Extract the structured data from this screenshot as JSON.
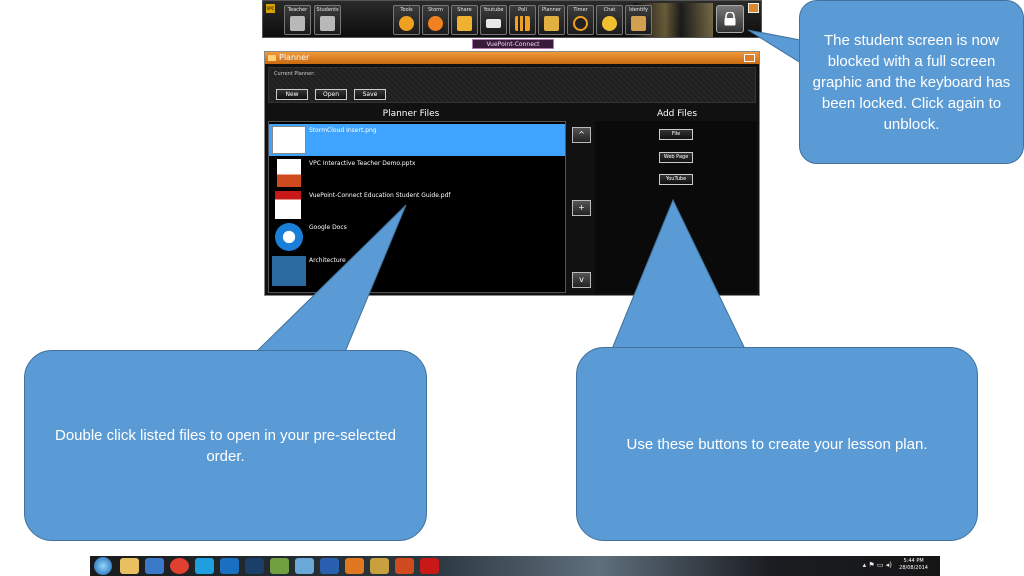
{
  "toolbar": {
    "logo_text": "VPC",
    "buttons": [
      {
        "id": "teacher",
        "label": "Teacher",
        "icon": "teacher-desk-icon",
        "color": "#b8b8b8"
      },
      {
        "id": "students",
        "label": "Students",
        "icon": "students-desk-icon",
        "color": "#b8b8b8"
      },
      {
        "id": "tools",
        "label": "Tools",
        "icon": "gear-tools-icon",
        "color": "#f0a020"
      },
      {
        "id": "storm",
        "label": "Storm",
        "icon": "storm-cloud-icon",
        "color": "#f08020"
      },
      {
        "id": "share",
        "label": "Share",
        "icon": "share-document-icon",
        "color": "#f0b030"
      },
      {
        "id": "youtube",
        "label": "Youtube",
        "icon": "youtube-icon",
        "color": "#e8e8e8"
      },
      {
        "id": "poll",
        "label": "Poll",
        "icon": "poll-chart-icon",
        "color": "#f0a020"
      },
      {
        "id": "planner",
        "label": "Planner",
        "icon": "planner-calendar-icon",
        "color": "#e0b040"
      },
      {
        "id": "timer",
        "label": "Timer",
        "icon": "timer-clock-icon",
        "color": "#f0a020"
      },
      {
        "id": "chat",
        "label": "Chat",
        "icon": "chat-bubble-icon",
        "color": "#f0c030"
      },
      {
        "id": "identify",
        "label": "Identify",
        "icon": "identify-desk-icon",
        "color": "#d0a050"
      }
    ],
    "lock_icon": "lock-icon",
    "brand": "VuePoint-Connect"
  },
  "planner": {
    "title": "Planner",
    "current_label": "Current Planner:",
    "buttons": {
      "new": "New",
      "open": "Open",
      "save": "Save"
    },
    "files_header": "Planner Files",
    "add_header": "Add Files",
    "files": [
      {
        "name": "StormCloud Insert.png",
        "icon": "image-thumbnail-icon",
        "selected": true
      },
      {
        "name": "VPC Interactive Teacher Demo.pptx",
        "icon": "powerpoint-file-icon",
        "selected": false
      },
      {
        "name": "VuePoint-Connect Education Student Guide.pdf",
        "icon": "pdf-file-icon",
        "selected": false
      },
      {
        "name": "Google Docs",
        "icon": "internet-explorer-icon",
        "selected": false
      },
      {
        "name": "Architecture",
        "icon": "video-thumbnail-icon",
        "selected": false
      }
    ],
    "scroll": {
      "up": "^",
      "middle": "+",
      "down": "v"
    },
    "add_buttons": {
      "file": "File",
      "webpage": "Web Page",
      "youtube": "YouTube"
    }
  },
  "callouts": {
    "lock": "The student screen is now blocked with a full screen graphic and the keyboard has been locked. Click again to unblock.",
    "files": "Double click listed files to open in your pre-selected order.",
    "buttons": "Use these buttons to create your lesson plan."
  },
  "taskbar": {
    "apps": [
      {
        "icon": "windows-start-icon",
        "color": "#1a5fa8"
      },
      {
        "icon": "file-explorer-icon",
        "color": "#e8c060"
      },
      {
        "icon": "media-player-icon",
        "color": "#3a78c8"
      },
      {
        "icon": "chrome-icon",
        "color": "#e04030"
      },
      {
        "icon": "skype-icon",
        "color": "#1ea0e0"
      },
      {
        "icon": "outlook-icon",
        "color": "#1a70c0"
      },
      {
        "icon": "photoshop-icon",
        "color": "#1c3f6a"
      },
      {
        "icon": "paint-icon",
        "color": "#70a040"
      },
      {
        "icon": "notepad-icon",
        "color": "#6aa8d8"
      },
      {
        "icon": "word-icon",
        "color": "#2a5fb0"
      },
      {
        "icon": "vpc-app-icon",
        "color": "#e07820"
      },
      {
        "icon": "pencil-app-icon",
        "color": "#c8a040"
      },
      {
        "icon": "powerpoint-icon",
        "color": "#d04a20"
      },
      {
        "icon": "acrobat-icon",
        "color": "#c81818"
      }
    ],
    "clock_time": "5:44 PM",
    "clock_date": "28/08/2014"
  }
}
